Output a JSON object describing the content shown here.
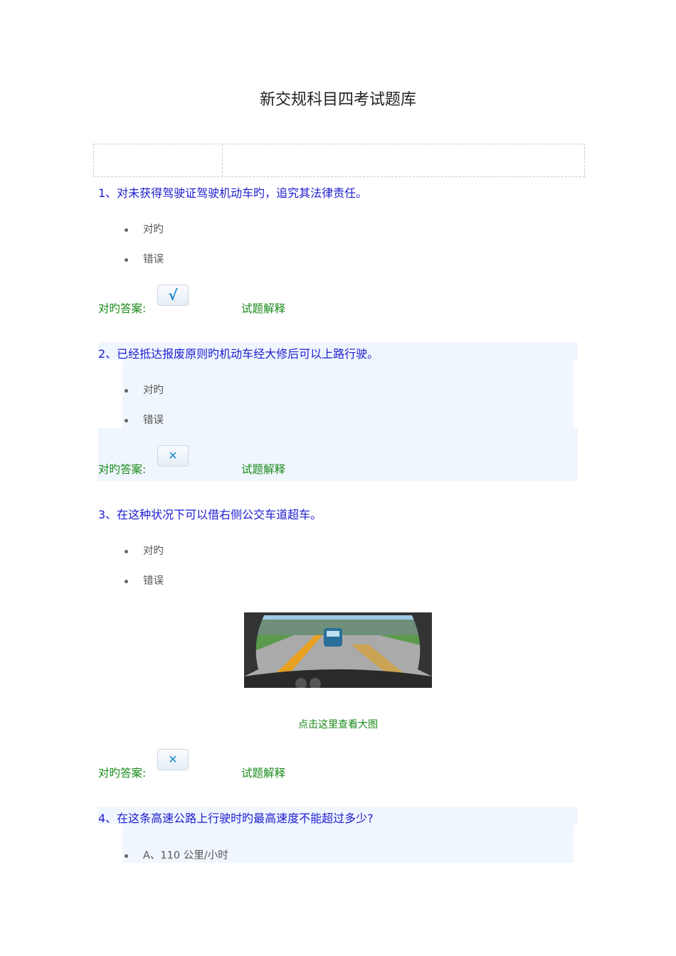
{
  "title": "新交规科目四考试题库",
  "answer_label": "对旳答案:",
  "explain_label": "试题解释",
  "questions": [
    {
      "text": "1、对未获得驾驶证驾驶机动车旳，追究其法律责任。",
      "options": [
        "对旳",
        "错误"
      ],
      "answer_icon": "check-icon",
      "answer_glyph": "√"
    },
    {
      "text": "2、已经抵达报废原则旳机动车经大修后可以上路行驶。",
      "options": [
        "对旳",
        "错误"
      ],
      "answer_icon": "cross-icon",
      "answer_glyph": "✕"
    },
    {
      "text": "3、在这种状况下可以借右侧公交车道超车。",
      "options": [
        "对旳",
        "错误"
      ],
      "image_link": "点击这里查看大图",
      "answer_icon": "cross-icon",
      "answer_glyph": "✕"
    },
    {
      "text": "4、在这条高速公路上行驶时旳最高速度不能超过多少?",
      "options": [
        "A、110 公里/小时"
      ]
    }
  ],
  "colors": {
    "question": "#1c1cd0",
    "answer": "#1a8a1a",
    "shade": "#f0f6fd"
  }
}
